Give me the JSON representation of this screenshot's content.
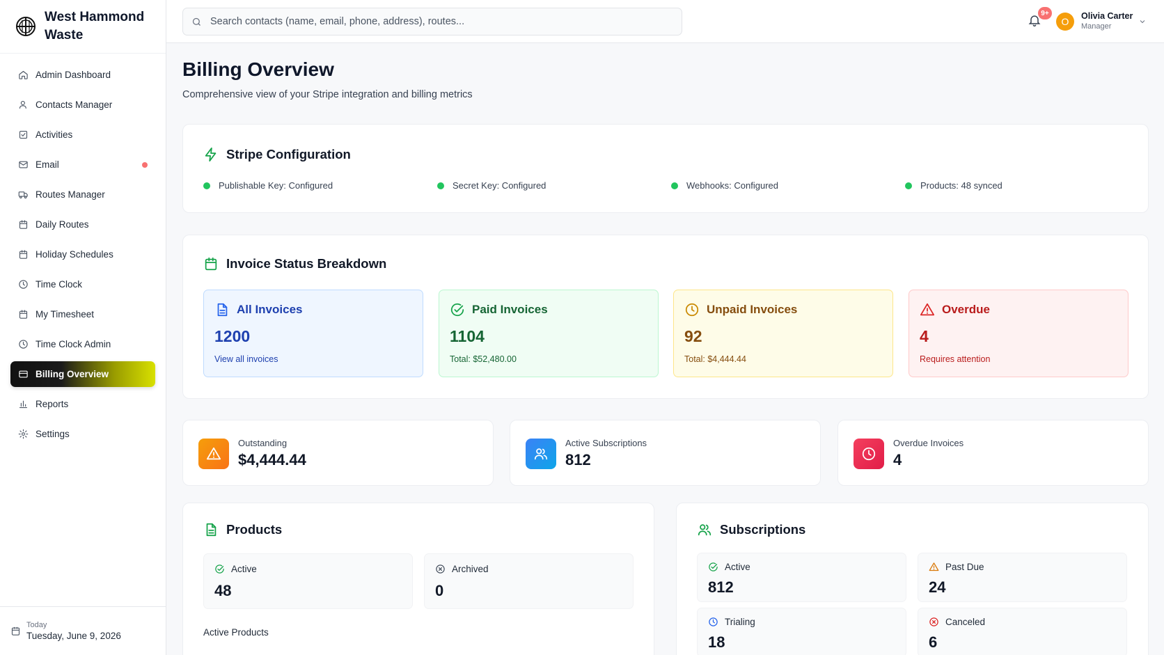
{
  "brand": {
    "name": "West Hammond Waste"
  },
  "sidebar": {
    "items": [
      {
        "label": "Admin Dashboard",
        "icon": "home-icon"
      },
      {
        "label": "Contacts Manager",
        "icon": "user-icon"
      },
      {
        "label": "Activities",
        "icon": "check-square-icon"
      },
      {
        "label": "Email",
        "icon": "mail-icon",
        "badge_color": "#f87171"
      },
      {
        "label": "Routes Manager",
        "icon": "truck-icon"
      },
      {
        "label": "Daily Routes",
        "icon": "calendar-icon"
      },
      {
        "label": "Holiday Schedules",
        "icon": "calendar-icon"
      },
      {
        "label": "Time Clock",
        "icon": "clock-icon"
      },
      {
        "label": "My Timesheet",
        "icon": "calendar-icon"
      },
      {
        "label": "Time Clock Admin",
        "icon": "clock-icon"
      },
      {
        "label": "Billing Overview",
        "icon": "credit-card-icon",
        "active": true
      },
      {
        "label": "Reports",
        "icon": "bar-chart-icon"
      },
      {
        "label": "Settings",
        "icon": "gear-icon"
      }
    ],
    "footer": {
      "label": "Today",
      "date": "Tuesday, June 9, 2026"
    }
  },
  "topbar": {
    "search_placeholder": "Search contacts (name, email, phone, address), routes...",
    "notifications_badge": "9+",
    "user": {
      "initial": "O",
      "name": "Olivia Carter",
      "role": "Manager",
      "avatar_color": "#f59e0b"
    }
  },
  "page": {
    "title": "Billing Overview",
    "subtitle": "Comprehensive view of your Stripe integration and billing metrics"
  },
  "stripe": {
    "title": "Stripe Configuration",
    "status_color": "#22c55e",
    "statuses": [
      "Publishable Key: Configured",
      "Secret Key: Configured",
      "Webhooks: Configured",
      "Products: 48 synced"
    ]
  },
  "invoices": {
    "title": "Invoice Status Breakdown",
    "all": {
      "title": "All Invoices",
      "count": "1200",
      "sub": "View all invoices"
    },
    "paid": {
      "title": "Paid Invoices",
      "count": "1104",
      "sub": "Total: $52,480.00"
    },
    "unpaid": {
      "title": "Unpaid Invoices",
      "count": "92",
      "sub": "Total: $4,444.44"
    },
    "overdue": {
      "title": "Overdue",
      "count": "4",
      "sub": "Requires attention"
    }
  },
  "stats": [
    {
      "label": "Outstanding",
      "value": "$4,444.44",
      "icon": "alert-triangle-icon"
    },
    {
      "label": "Active Subscriptions",
      "value": "812",
      "icon": "users-icon"
    },
    {
      "label": "Overdue Invoices",
      "value": "4",
      "icon": "clock-icon"
    }
  ],
  "products": {
    "title": "Products",
    "active": {
      "label": "Active",
      "value": "48"
    },
    "archived": {
      "label": "Archived",
      "value": "0"
    },
    "section_label": "Active Products"
  },
  "subscriptions": {
    "title": "Subscriptions",
    "active": {
      "label": "Active",
      "value": "812"
    },
    "past_due": {
      "label": "Past Due",
      "value": "24"
    },
    "trialing": {
      "label": "Trialing",
      "value": "18"
    },
    "canceled": {
      "label": "Canceled",
      "value": "6"
    }
  }
}
